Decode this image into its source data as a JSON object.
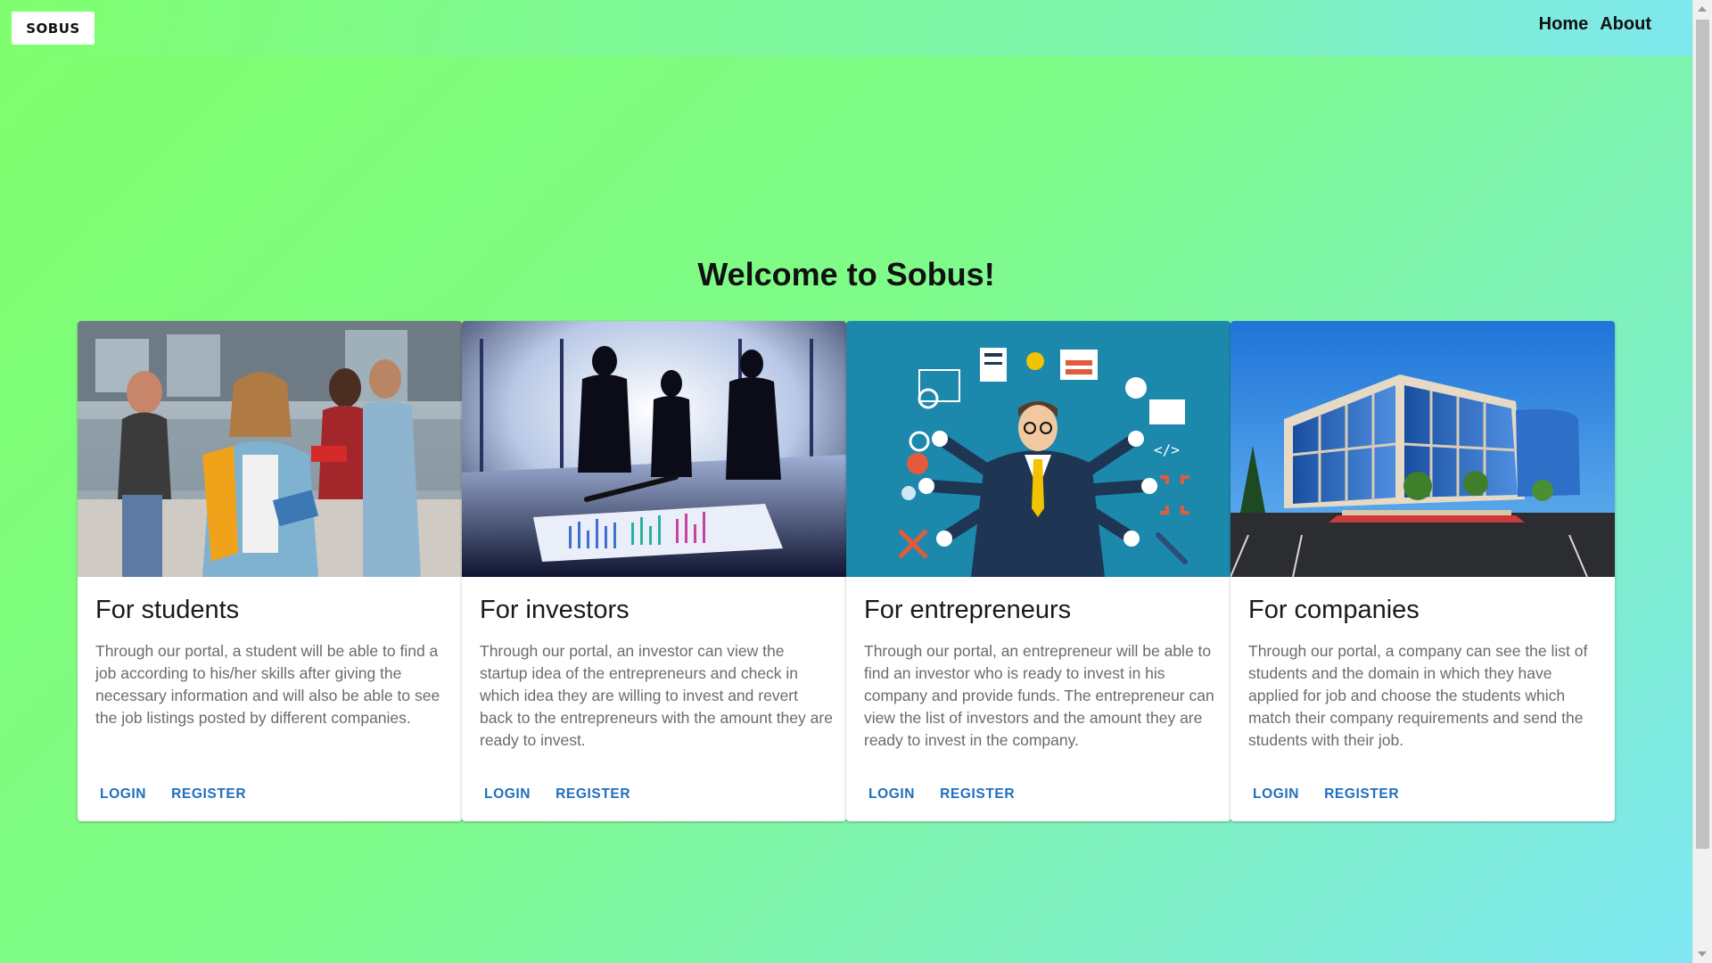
{
  "header": {
    "logo_text": "SOBUS",
    "nav": [
      {
        "label": "Home"
      },
      {
        "label": "About"
      }
    ]
  },
  "main": {
    "welcome": "Welcome to Sobus!",
    "cards": [
      {
        "title": "For students",
        "description": "Through our portal, a student will be able to find a job according to his/her skills after giving the necessary information and will also be able to see the job listings posted by different companies.",
        "login_label": "LOGIN",
        "register_label": "REGISTER"
      },
      {
        "title": "For investors",
        "description": "Through our portal, an investor can view the startup idea of the entrepreneurs and check in which idea they are willing to invest and revert back to the entrepreneurs with the amount they are ready to invest.",
        "login_label": "LOGIN",
        "register_label": "REGISTER"
      },
      {
        "title": "For entrepreneurs",
        "description": "Through our portal, an entrepreneur will be able to find an investor who is ready to invest in his company and provide funds. The entrepreneur can view the list of investors and the amount they are ready to invest in the company.",
        "login_label": "LOGIN",
        "register_label": "REGISTER"
      },
      {
        "title": "For companies",
        "description": "Through our portal, a company can see the list of students and the domain in which they have applied for job and choose the students which match their company requirements and send the students with their job.",
        "login_label": "LOGIN",
        "register_label": "REGISTER"
      }
    ]
  },
  "colors": {
    "accent": "#1f6fbf",
    "background_start": "#7fff6e",
    "background_end": "#7fe6f5"
  }
}
